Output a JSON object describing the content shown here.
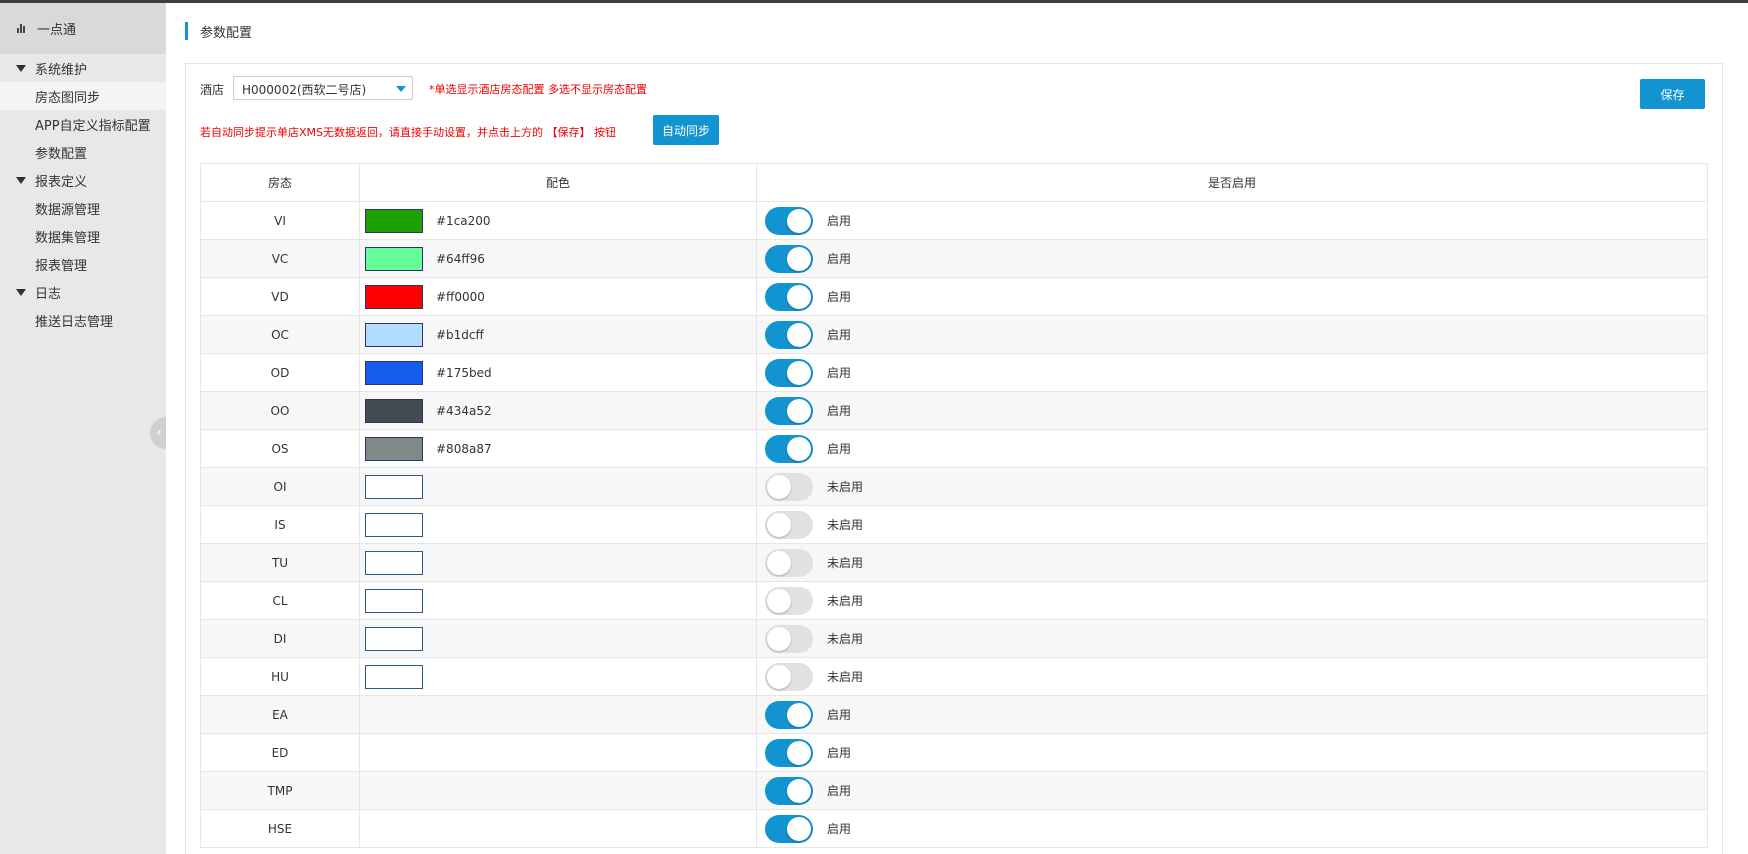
{
  "brand": "一点通",
  "sidebar": [
    {
      "type": "group",
      "label": "系统维护"
    },
    {
      "type": "item",
      "label": "房态图同步",
      "active": true
    },
    {
      "type": "item",
      "label": "APP自定义指标配置"
    },
    {
      "type": "item",
      "label": "参数配置"
    },
    {
      "type": "group",
      "label": "报表定义"
    },
    {
      "type": "item",
      "label": "数据源管理"
    },
    {
      "type": "item",
      "label": "数据集管理"
    },
    {
      "type": "item",
      "label": "报表管理"
    },
    {
      "type": "group",
      "label": "日志"
    },
    {
      "type": "item",
      "label": "推送日志管理"
    }
  ],
  "page_title": "参数配置",
  "form": {
    "hotel_label": "酒店",
    "hotel_value": "H000002(西软二号店)",
    "notice_single": "*单选显示酒店房态配置 多选不显示房态配置",
    "notice_sync": "若自动同步提示单店XMS无数据返回，请直接手动设置，并点击上方的 【保存】 按钮",
    "sync_button": "自动同步",
    "save_button": "保存"
  },
  "table": {
    "headers": [
      "房态",
      "配色",
      "是否启用"
    ],
    "rows": [
      {
        "state": "VI",
        "color": "#1ca200",
        "hex": "#1ca200",
        "enabled": true,
        "status": "启用"
      },
      {
        "state": "VC",
        "color": "#64ff96",
        "hex": "#64ff96",
        "enabled": true,
        "status": "启用"
      },
      {
        "state": "VD",
        "color": "#ff0000",
        "hex": "#ff0000",
        "enabled": true,
        "status": "启用"
      },
      {
        "state": "OC",
        "color": "#b1dcff",
        "hex": "#b1dcff",
        "enabled": true,
        "status": "启用"
      },
      {
        "state": "OD",
        "color": "#175bed",
        "hex": "#175bed",
        "enabled": true,
        "status": "启用"
      },
      {
        "state": "OO",
        "color": "#434a52",
        "hex": "#434a52",
        "enabled": true,
        "status": "启用"
      },
      {
        "state": "OS",
        "color": "#808a87",
        "hex": "#808a87",
        "enabled": true,
        "status": "启用"
      },
      {
        "state": "OI",
        "color": "",
        "hex": "",
        "enabled": false,
        "status": "未启用",
        "swatch": true
      },
      {
        "state": "IS",
        "color": "",
        "hex": "",
        "enabled": false,
        "status": "未启用",
        "swatch": true
      },
      {
        "state": "TU",
        "color": "",
        "hex": "",
        "enabled": false,
        "status": "未启用",
        "swatch": true
      },
      {
        "state": "CL",
        "color": "",
        "hex": "",
        "enabled": false,
        "status": "未启用",
        "swatch": true
      },
      {
        "state": "DI",
        "color": "",
        "hex": "",
        "enabled": false,
        "status": "未启用",
        "swatch": true
      },
      {
        "state": "HU",
        "color": "",
        "hex": "",
        "enabled": false,
        "status": "未启用",
        "swatch": true
      },
      {
        "state": "EA",
        "color": "",
        "hex": "",
        "enabled": true,
        "status": "启用",
        "swatch": false
      },
      {
        "state": "ED",
        "color": "",
        "hex": "",
        "enabled": true,
        "status": "启用",
        "swatch": false
      },
      {
        "state": "TMP",
        "color": "",
        "hex": "",
        "enabled": true,
        "status": "启用",
        "swatch": false
      },
      {
        "state": "HSE",
        "color": "",
        "hex": "",
        "enabled": true,
        "status": "启用",
        "swatch": false
      }
    ]
  },
  "colors": {
    "accent": "#1294d0",
    "warning": "#ee0000"
  }
}
